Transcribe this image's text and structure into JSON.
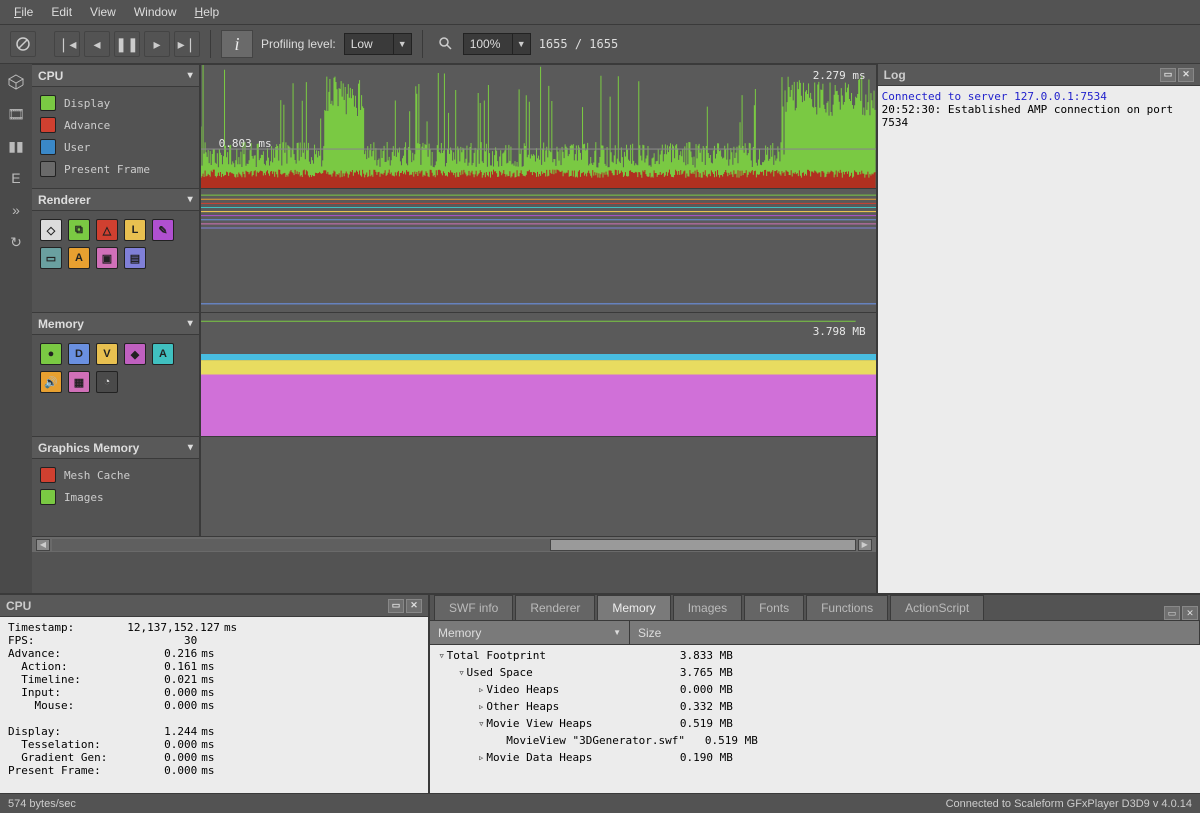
{
  "menu": {
    "items": [
      "File",
      "Edit",
      "View",
      "Window",
      "Help"
    ]
  },
  "toolbar": {
    "profiling_label": "Profiling level:",
    "profiling_value": "Low",
    "zoom_value": "100%",
    "frame_counter": "1655 / 1655"
  },
  "panels": {
    "cpu": {
      "title": "CPU",
      "annot_top": "2.279 ms",
      "annot_mid": "0.803 ms",
      "legend": [
        {
          "label": "Display",
          "color": "#7ac943"
        },
        {
          "label": "Advance",
          "color": "#d04030"
        },
        {
          "label": "User",
          "color": "#3a88c8"
        },
        {
          "label": "Present Frame",
          "color": "#6a6a6a"
        }
      ]
    },
    "renderer": {
      "title": "Renderer",
      "icons": [
        {
          "bg": "#dcdcdc",
          "ch": "◇"
        },
        {
          "bg": "#7ac943",
          "ch": "⧉"
        },
        {
          "bg": "#d04030",
          "ch": "△"
        },
        {
          "bg": "#e8c050",
          "ch": "L"
        },
        {
          "bg": "#b050d0",
          "ch": "✎"
        },
        {
          "bg": "#6aa0a0",
          "ch": "▭"
        },
        {
          "bg": "#e8a030",
          "ch": "A"
        },
        {
          "bg": "#d070b8",
          "ch": "▣"
        },
        {
          "bg": "#8080d8",
          "ch": "▤"
        }
      ]
    },
    "memory": {
      "title": "Memory",
      "annot": "3.798 MB",
      "icons": [
        {
          "bg": "#7ac943",
          "ch": "●"
        },
        {
          "bg": "#6a90e0",
          "ch": "D"
        },
        {
          "bg": "#e8c050",
          "ch": "V"
        },
        {
          "bg": "#c060c0",
          "ch": "◆"
        },
        {
          "bg": "#40c0c0",
          "ch": "A"
        },
        {
          "bg": "#e8a030",
          "ch": "🔊"
        },
        {
          "bg": "#d070b8",
          "ch": "▦"
        },
        {
          "bg": "#4a4a4a",
          "ch": "◔"
        }
      ]
    },
    "gmem": {
      "title": "Graphics Memory",
      "legend": [
        {
          "label": "Mesh Cache",
          "color": "#d04030"
        },
        {
          "label": "Images",
          "color": "#7ac943"
        }
      ]
    }
  },
  "log": {
    "title": "Log",
    "lines": [
      {
        "cls": "blue",
        "text": "Connected to server 127.0.0.1:7534"
      },
      {
        "cls": "",
        "text": "20:52:30: Established AMP connection on port 7534"
      }
    ]
  },
  "cpu_detail": {
    "title": "CPU",
    "rows": [
      {
        "k": "Timestamp: ",
        "v": "12,137,152.127",
        "u": "ms",
        "ind": 0
      },
      {
        "k": "FPS: ",
        "v": "30",
        "u": "",
        "ind": 0
      },
      {
        "k": "Advance:",
        "v": "0.216",
        "u": "ms",
        "ind": 0
      },
      {
        "k": "Action:",
        "v": "0.161",
        "u": "ms",
        "ind": 1
      },
      {
        "k": "Timeline:",
        "v": "0.021",
        "u": "ms",
        "ind": 1
      },
      {
        "k": "Input:",
        "v": "0.000",
        "u": "ms",
        "ind": 1
      },
      {
        "k": "Mouse:",
        "v": "0.000",
        "u": "ms",
        "ind": 2
      },
      {
        "k": "",
        "v": "",
        "u": "",
        "ind": 0
      },
      {
        "k": "Display:",
        "v": "1.244",
        "u": "ms",
        "ind": 0
      },
      {
        "k": "Tesselation:",
        "v": "0.000",
        "u": "ms",
        "ind": 1
      },
      {
        "k": "Gradient Gen:",
        "v": "0.000",
        "u": "ms",
        "ind": 1
      },
      {
        "k": "Present Frame:",
        "v": "0.000",
        "u": "ms",
        "ind": 0
      }
    ]
  },
  "tabs": {
    "items": [
      "SWF info",
      "Renderer",
      "Memory",
      "Images",
      "Fonts",
      "Functions",
      "ActionScript"
    ],
    "active": 2,
    "columns": [
      "Memory",
      "Size"
    ],
    "rows": [
      {
        "ind": 0,
        "arr": "▿",
        "label": "Total Footprint",
        "val": "3.833 MB"
      },
      {
        "ind": 1,
        "arr": "▿",
        "label": "Used Space",
        "val": "3.765 MB"
      },
      {
        "ind": 2,
        "arr": "▹",
        "label": "Video Heaps",
        "val": "0.000 MB"
      },
      {
        "ind": 2,
        "arr": "▹",
        "label": "Other Heaps",
        "val": "0.332 MB"
      },
      {
        "ind": 2,
        "arr": "▿",
        "label": "Movie View Heaps",
        "val": "0.519 MB"
      },
      {
        "ind": 3,
        "arr": " ",
        "label": "MovieView \"3DGenerator.swf\"",
        "val": "0.519 MB"
      },
      {
        "ind": 2,
        "arr": "▹",
        "label": "Movie Data Heaps",
        "val": "0.190 MB"
      }
    ]
  },
  "status": {
    "left": "574 bytes/sec",
    "right": "Connected to Scaleform GFxPlayer D3D9 v 4.0.14"
  },
  "chart_data": {
    "cpu_graph": {
      "type": "area",
      "series": [
        "Display",
        "Advance",
        "User",
        "Present Frame"
      ],
      "y_top_ms": 2.279,
      "y_mid_ms": 0.803,
      "note": "dense per-frame timing, ~1655 frames, green dominant with red base band"
    },
    "memory_graph": {
      "type": "area",
      "value_mb": 3.798,
      "bands": [
        {
          "name": "band1",
          "color": "#48bde0",
          "frac": 0.05
        },
        {
          "name": "band2",
          "color": "#e8dc60",
          "frac": 0.1
        },
        {
          "name": "band3",
          "color": "#d070d8",
          "frac": 0.85
        }
      ]
    }
  }
}
